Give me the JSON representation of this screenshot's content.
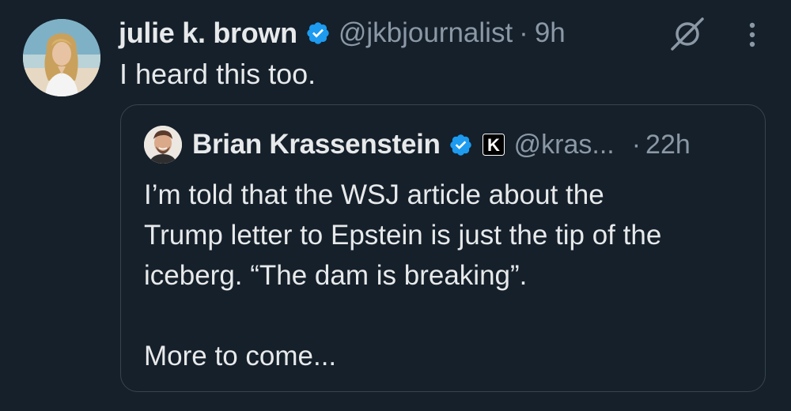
{
  "tweet": {
    "author": {
      "display_name": "julie k. brown",
      "handle": "@jkbjournalist",
      "verified": true
    },
    "separator": "·",
    "time": "9h",
    "text": "I heard this too.",
    "icons": {
      "grok": "grok-icon",
      "more": "more-options-icon"
    }
  },
  "quoted_tweet": {
    "author": {
      "display_name": "Brian Krassenstein",
      "handle": "@kras...",
      "verified": true,
      "affiliate_badge": "K"
    },
    "separator": "·",
    "time": "22h",
    "text_lines": [
      "I’m told that the WSJ article about the",
      "Trump letter to Epstein is just the tip of the",
      "iceberg. “The dam is breaking”.",
      "",
      "More to come..."
    ]
  },
  "colors": {
    "background": "#15202b",
    "primary_text": "#e7e9ea",
    "secondary_text": "#8b98a5",
    "verified_blue": "#1d9bf0",
    "border": "#38444d"
  }
}
